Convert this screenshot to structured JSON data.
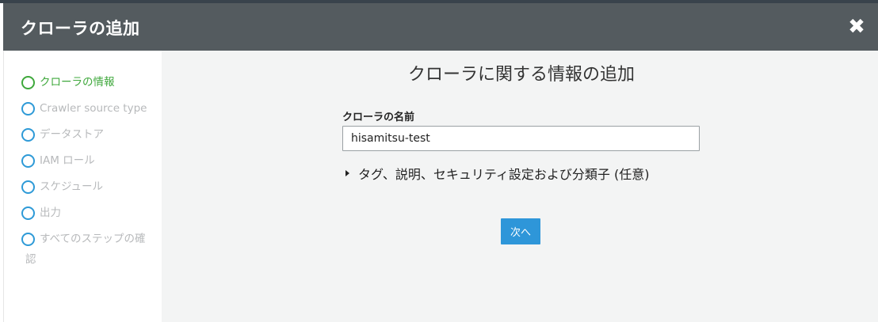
{
  "dialog": {
    "title": "クローラの追加",
    "close_icon": "close-icon"
  },
  "sidebar": {
    "steps": [
      {
        "label": "クローラの情報",
        "active": true
      },
      {
        "label": "Crawler source type",
        "active": false
      },
      {
        "label": "データストア",
        "active": false
      },
      {
        "label": "IAM ロール",
        "active": false
      },
      {
        "label": "スケジュール",
        "active": false
      },
      {
        "label": "出力",
        "active": false
      },
      {
        "label": "すべてのステップの確",
        "label_line2": "認",
        "active": false
      }
    ]
  },
  "main": {
    "title": "クローラに関する情報の追加",
    "name_label": "クローラの名前",
    "name_value": "hisamitsu-test",
    "expander_label": "タグ、説明、セキュリティ設定および分類子 (任意)",
    "next_label": "次へ"
  },
  "colors": {
    "header_bg": "#545b5f",
    "active_step": "#3fa83c",
    "step_circle": "#2e9ad7",
    "primary_button": "#2e96d9"
  }
}
